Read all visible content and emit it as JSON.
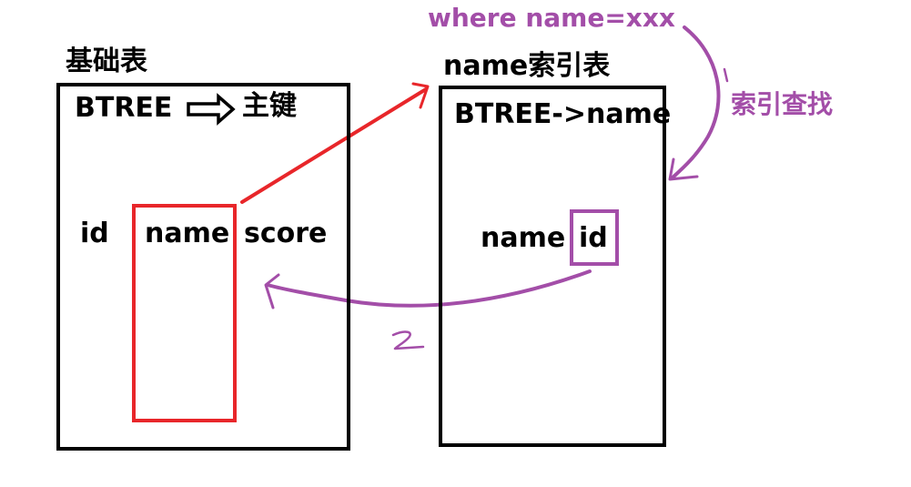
{
  "base_table": {
    "title": "基础表",
    "btree": "BTREE",
    "primary_key": "主键",
    "columns": [
      "id",
      "name",
      "score"
    ]
  },
  "index_table": {
    "title": "name索引表",
    "btree": "BTREE->name",
    "columns": [
      "name",
      "id"
    ]
  },
  "query": {
    "text": "where name=xxx",
    "step_label": "索引查找",
    "step1": "1",
    "step2": "2"
  },
  "colors": {
    "black": "#000000",
    "red": "#e8262a",
    "purple": "#a34ea8"
  }
}
